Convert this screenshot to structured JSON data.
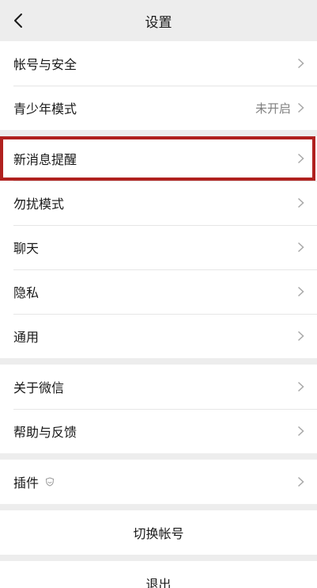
{
  "header": {
    "title": "设置"
  },
  "groups": [
    {
      "items": [
        {
          "label": "帐号与安全"
        },
        {
          "label": "青少年模式",
          "value": "未开启"
        }
      ]
    },
    {
      "items": [
        {
          "label": "新消息提醒"
        },
        {
          "label": "勿扰模式"
        },
        {
          "label": "聊天"
        },
        {
          "label": "隐私"
        },
        {
          "label": "通用"
        }
      ]
    },
    {
      "items": [
        {
          "label": "关于微信"
        },
        {
          "label": "帮助与反馈"
        }
      ]
    },
    {
      "items": [
        {
          "label": "插件",
          "icon": "shield-icon"
        }
      ]
    }
  ],
  "buttons": {
    "switch_account": "切换帐号",
    "logout": "退出"
  },
  "colors": {
    "background": "#ededed",
    "card": "#ffffff",
    "highlight_border": "#b0211f",
    "secondary_text": "#7f7f7f"
  }
}
